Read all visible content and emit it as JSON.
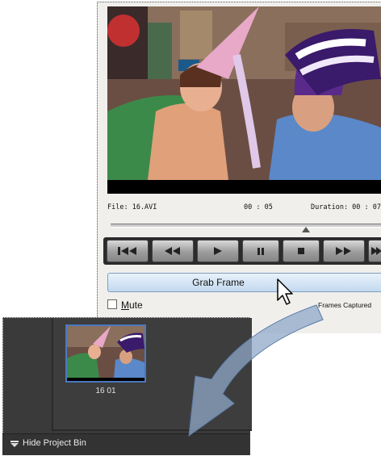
{
  "dialog": {
    "info": {
      "file": "File: 16.AVI",
      "timecode": "00 : 05",
      "duration": "Duration:  00 : 07"
    },
    "grab_button_label": "Grab Frame",
    "mute_label_prefix": "",
    "mute_label_m": "M",
    "mute_label_rest": "ute",
    "frames_captured": "Frames Captured"
  },
  "transport": {
    "buttons": [
      "skip-back-icon",
      "rewind-icon",
      "play-icon",
      "pause-icon",
      "stop-icon",
      "fast-forward-icon",
      "skip-forward-icon"
    ]
  },
  "project_bin": {
    "thumbnail_caption": "16 01",
    "hide_label": "Hide Project Bin"
  },
  "colors": {
    "bin_bg": "#3a3a3a",
    "grab_button": "#c3d9ef",
    "selection_border": "#4a78c0",
    "arrow": "#8fa8c8"
  }
}
